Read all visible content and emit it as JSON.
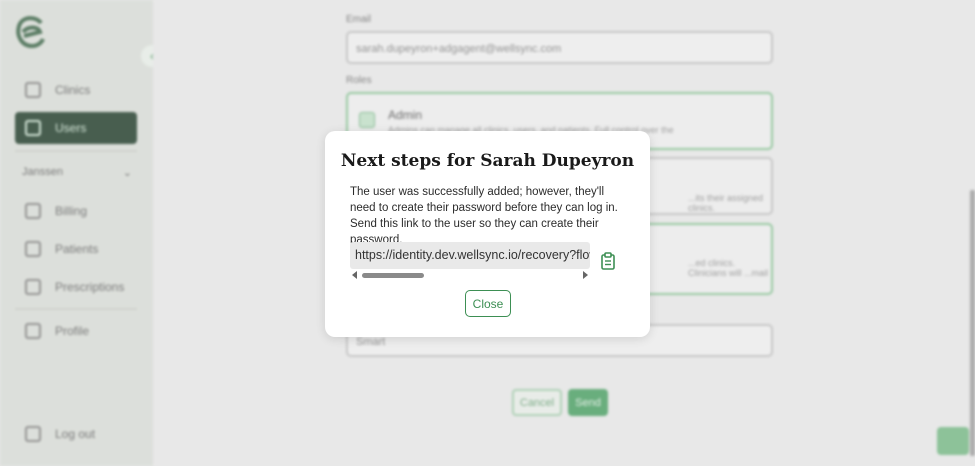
{
  "sidebar": {
    "items": [
      {
        "label": "Clinics",
        "icon": "document-icon"
      },
      {
        "label": "Users",
        "icon": "users-icon"
      },
      {
        "label": "Billing",
        "icon": "calendar-icon"
      },
      {
        "label": "Patients",
        "icon": "heart-icon"
      },
      {
        "label": "Prescriptions",
        "icon": "prescription-icon"
      },
      {
        "label": "Profile",
        "icon": "gear-icon"
      }
    ],
    "group_label": "Janssen",
    "logout_label": "Log out"
  },
  "form": {
    "email_label": "Email",
    "email_value": "sarah.dupeyron+adgagent@wellsync.com",
    "roles_label": "Roles",
    "roles": [
      {
        "title": "Admin",
        "desc": "Admins can manage all clinics, users, and patients. Full control over the"
      },
      {
        "title": "",
        "desc": "...its their assigned clinics."
      },
      {
        "title": "",
        "desc": "...ed clinics. Clinicians will ...mail"
      }
    ],
    "select_value": "Smart",
    "cancel_label": "Cancel",
    "send_label": "Send"
  },
  "modal": {
    "title": "Next steps for Sarah Dupeyron",
    "body": "The user was successfully added; however, they'll need to create their password before they can log in. Send this link to the user so they can create their password.",
    "link": "https://identity.dev.wellsync.io/recovery?flow=",
    "close_label": "Close"
  },
  "colors": {
    "accent": "#3d8f54",
    "sidebar_active": "#13311d"
  }
}
